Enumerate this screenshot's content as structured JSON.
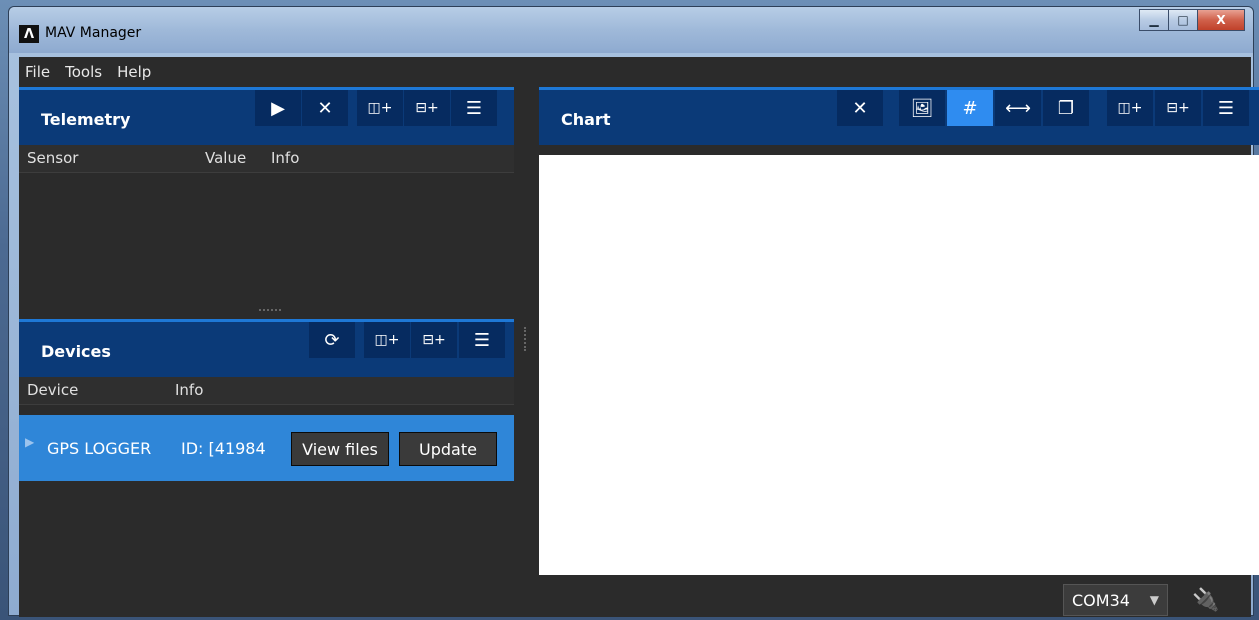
{
  "window": {
    "title": "MAV Manager",
    "controls": {
      "minimize": "▁",
      "maximize": "□",
      "close": "X"
    }
  },
  "menu": [
    "File",
    "Tools",
    "Help"
  ],
  "telemetry": {
    "title": "Telemetry",
    "columns": [
      "Sensor",
      "Value",
      "Info"
    ],
    "toolbar": {
      "play": "▶",
      "close": "✕",
      "add_col": "◫+",
      "add_row": "⊟+",
      "menu": "☰"
    }
  },
  "devices": {
    "title": "Devices",
    "columns": [
      "Device",
      "Info"
    ],
    "toolbar": {
      "refresh": "⟳",
      "add_col": "◫+",
      "add_row": "⊟+",
      "menu": "☰"
    },
    "rows": [
      {
        "name": "GPS LOGGER",
        "info": "ID: [41984",
        "view_files": "View files",
        "update": "Update"
      }
    ]
  },
  "chart": {
    "title": "Chart",
    "toolbar": {
      "close": "✕",
      "image": "🖼",
      "grid": "#",
      "fit": "⟷",
      "copy": "❐",
      "add_col": "◫+",
      "add_row": "⊟+",
      "menu": "☰"
    }
  },
  "status": {
    "port": "COM34",
    "connect_icon": "🔌"
  }
}
